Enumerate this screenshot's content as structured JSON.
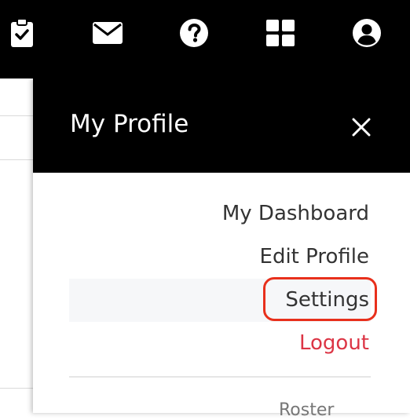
{
  "topnav": {
    "icons": [
      "clipboard-check-icon",
      "envelope-icon",
      "question-circle-icon",
      "grid-icon",
      "user-circle-icon"
    ]
  },
  "panel": {
    "title": "My Profile",
    "close_icon": "close-icon",
    "items": [
      {
        "label": "My Dashboard"
      },
      {
        "label": "Edit Profile"
      },
      {
        "label": "Settings",
        "state": "hovered",
        "annotated": true
      },
      {
        "label": "Logout",
        "color": "#dc3545"
      }
    ],
    "partial_next_label": "Roster"
  },
  "colors": {
    "header_bg": "#000000",
    "logout": "#dc3545",
    "annotation": "#e8301c",
    "hover_bg": "#f6f7f9"
  }
}
